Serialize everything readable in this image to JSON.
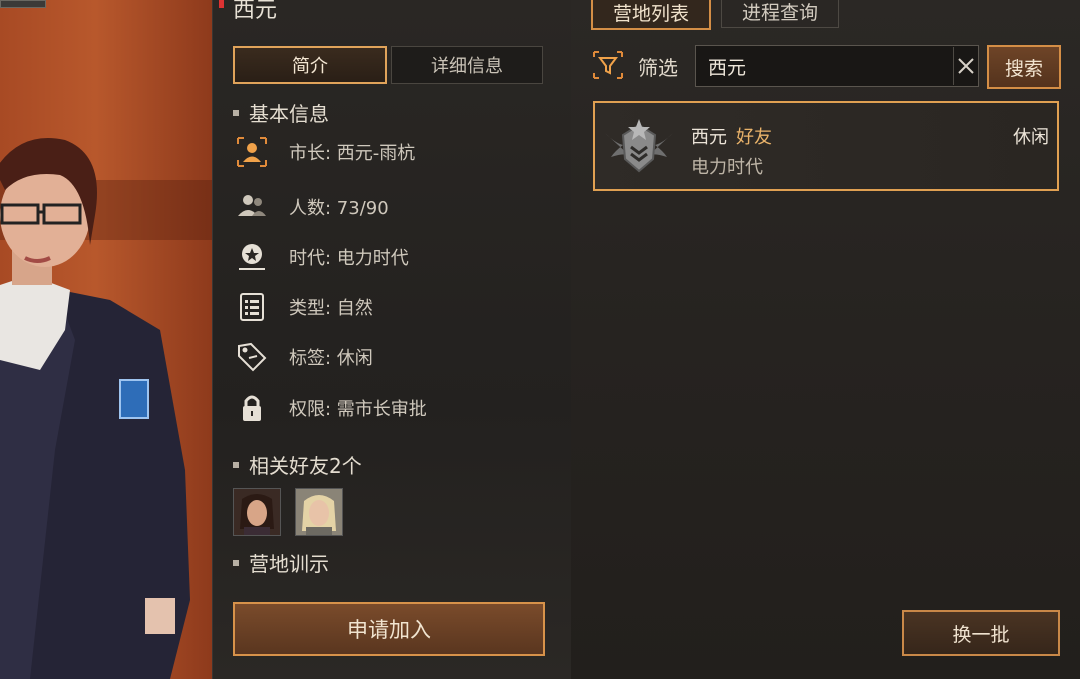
{
  "camp": {
    "name": "西元"
  },
  "subtabs": [
    "简介",
    "详细信息"
  ],
  "sections": {
    "basic_info": "基本信息",
    "friends": "相关好友2个",
    "motto": "营地训示"
  },
  "info_rows": [
    {
      "icon": "mayor-icon",
      "text": "市长: 西元-雨杭"
    },
    {
      "icon": "population-icon",
      "text": "人数: 73/90"
    },
    {
      "icon": "era-icon",
      "text": "时代: 电力时代"
    },
    {
      "icon": "type-icon",
      "text": "类型: 自然"
    },
    {
      "icon": "tag-icon",
      "text": "标签: 休闲"
    },
    {
      "icon": "lock-icon",
      "text": "权限: 需市长审批"
    }
  ],
  "friends": [
    {
      "name": "friend-avatar-1"
    },
    {
      "name": "friend-avatar-2"
    }
  ],
  "apply_label": "申请加入",
  "top_tabs": [
    "营地列表",
    "进程查询"
  ],
  "filter_label": "筛选",
  "search": {
    "value": "西元",
    "button": "搜索"
  },
  "results": [
    {
      "name": "西元",
      "badge": "好友",
      "era": "电力时代",
      "tag": "休闲"
    }
  ],
  "refresh_label": "换一批",
  "colors": {
    "accent": "#e0a052",
    "friend": "#eab36a",
    "alert": "#dd3333"
  }
}
